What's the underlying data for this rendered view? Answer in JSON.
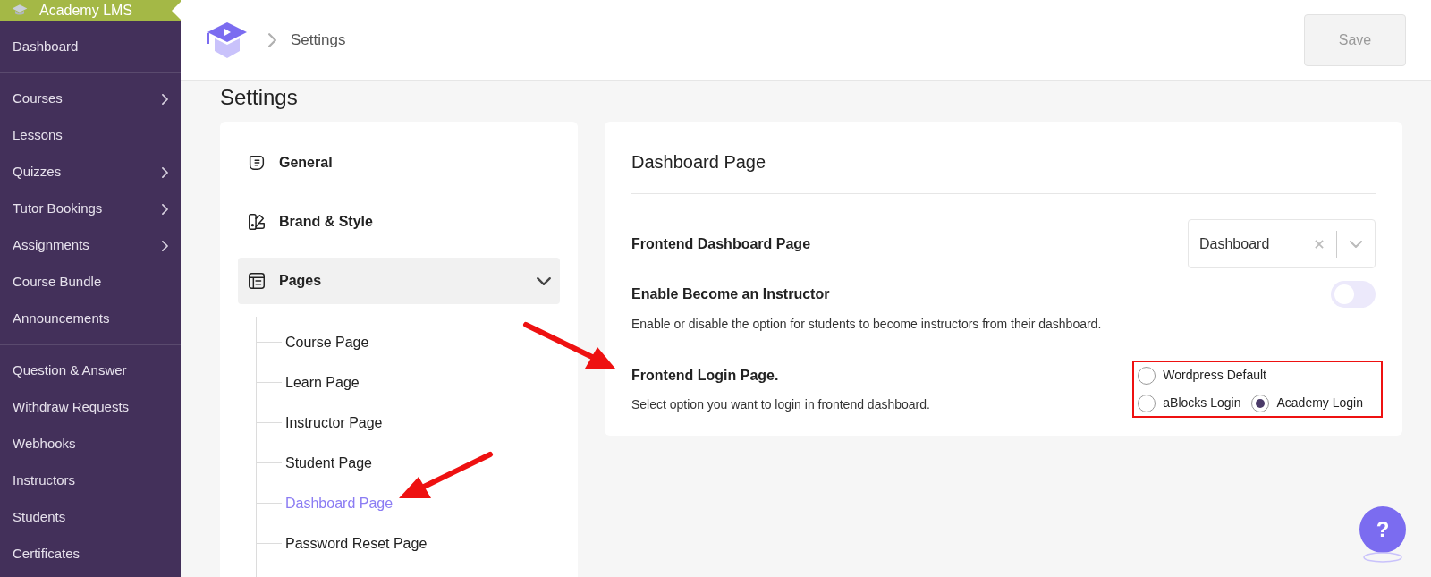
{
  "sidebar": {
    "brand": "Academy LMS",
    "groups": [
      [
        {
          "label": "Dashboard",
          "expandable": false
        }
      ],
      [
        {
          "label": "Courses",
          "expandable": true
        },
        {
          "label": "Lessons",
          "expandable": false
        },
        {
          "label": "Quizzes",
          "expandable": true
        },
        {
          "label": "Tutor Bookings",
          "expandable": true
        },
        {
          "label": "Assignments",
          "expandable": true
        },
        {
          "label": "Course Bundle",
          "expandable": false
        },
        {
          "label": "Announcements",
          "expandable": false
        }
      ],
      [
        {
          "label": "Question & Answer",
          "expandable": false
        },
        {
          "label": "Withdraw Requests",
          "expandable": false
        },
        {
          "label": "Webhooks",
          "expandable": false
        },
        {
          "label": "Instructors",
          "expandable": false
        },
        {
          "label": "Students",
          "expandable": false
        },
        {
          "label": "Certificates",
          "expandable": false
        }
      ]
    ]
  },
  "header": {
    "breadcrumb": "Settings",
    "save_button": {
      "label": "Save",
      "disabled": true
    }
  },
  "page_title": "Settings",
  "settings_nav": [
    {
      "label": "General",
      "expanded": false
    },
    {
      "label": "Brand & Style",
      "expanded": false
    },
    {
      "label": "Pages",
      "expanded": true,
      "children": [
        {
          "label": "Course Page",
          "selected": false
        },
        {
          "label": "Learn Page",
          "selected": false
        },
        {
          "label": "Instructor Page",
          "selected": false
        },
        {
          "label": "Student Page",
          "selected": false
        },
        {
          "label": "Dashboard Page",
          "selected": true
        },
        {
          "label": "Password Reset Page",
          "selected": false
        }
      ]
    }
  ],
  "panel": {
    "title": "Dashboard Page",
    "fields": [
      {
        "kind": "select",
        "label": "Frontend Dashboard Page",
        "value": "Dashboard"
      },
      {
        "kind": "toggle",
        "label": "Enable Become an Instructor",
        "description": "Enable or disable the option for students to become instructors from their dashboard.",
        "on": false
      },
      {
        "kind": "radio",
        "label": "Frontend Login Page.",
        "description": "Select option you want to login in frontend dashboard.",
        "options": [
          {
            "label": "Wordpress Default",
            "selected": false
          },
          {
            "label": "aBlocks Login",
            "selected": false
          },
          {
            "label": "Academy Login",
            "selected": true
          }
        ]
      }
    ]
  },
  "help_button": "?"
}
